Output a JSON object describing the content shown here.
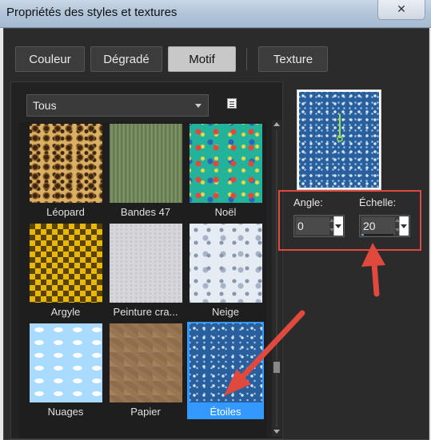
{
  "window": {
    "title": "Propriétés des styles et textures",
    "close_glyph": "✕"
  },
  "tabs": [
    {
      "label": "Couleur",
      "active": false
    },
    {
      "label": "Dégradé",
      "active": false
    },
    {
      "label": "Motif",
      "active": true
    },
    {
      "label": "Texture",
      "active": false
    }
  ],
  "category_dropdown": {
    "value": "Tous"
  },
  "patterns": [
    {
      "label": "Léopard",
      "selected": false,
      "icon": "leopard-pattern"
    },
    {
      "label": "Bandes 47",
      "selected": false,
      "icon": "green-stripes-pattern"
    },
    {
      "label": "Noël",
      "selected": false,
      "icon": "christmas-pattern"
    },
    {
      "label": "Argyle",
      "selected": false,
      "icon": "argyle-pattern"
    },
    {
      "label": "Peinture cra...",
      "selected": false,
      "icon": "crackle-paint-pattern"
    },
    {
      "label": "Neige",
      "selected": false,
      "icon": "snow-pattern"
    },
    {
      "label": "Nuages",
      "selected": false,
      "icon": "clouds-pattern"
    },
    {
      "label": "Papier",
      "selected": false,
      "icon": "paper-pattern"
    },
    {
      "label": "Étoiles",
      "selected": true,
      "icon": "stars-pattern"
    }
  ],
  "angle": {
    "label": "Angle:",
    "value": "0"
  },
  "scale": {
    "label": "Échelle:",
    "value": "20"
  },
  "colors": {
    "selection": "#3399ff",
    "highlight": "#e04a3e",
    "panel": "#2b2b2b"
  }
}
